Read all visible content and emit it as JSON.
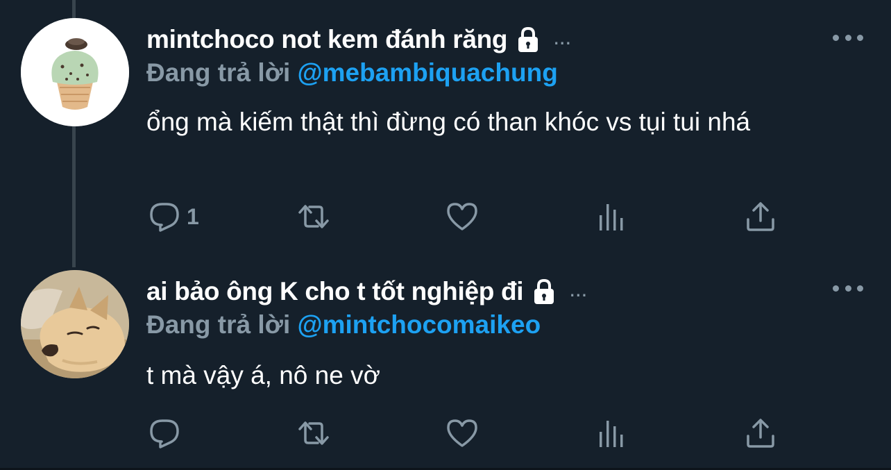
{
  "tweets": [
    {
      "display_name": "mintchoco not kem đánh răng",
      "ellipsis": "...",
      "reply_label": "Đang trả lời",
      "reply_handle": "@mebambiquachung",
      "text": "ổng mà kiếm thật thì đừng có than khóc vs tụi tui nhá",
      "reply_count": "1",
      "avatar": "mint-chocolate-ice-cream-avatar",
      "locked": true
    },
    {
      "display_name": "ai bảo ông K cho t tốt nghiệp đi",
      "ellipsis": "...",
      "reply_label": "Đang trả lời",
      "reply_handle": "@mintchocomaikeo",
      "text": "t mà vậy á, nô ne vờ",
      "reply_count": "",
      "avatar": "sleeping-dog-avatar",
      "locked": true
    }
  ],
  "icons": [
    "reply-icon",
    "retweet-icon",
    "like-icon",
    "analytics-icon",
    "share-icon",
    "lock-icon",
    "more-icon"
  ],
  "colors": {
    "background": "#15202b",
    "muted": "#8899a6",
    "accent": "#1da1f2",
    "text": "#ffffff"
  }
}
